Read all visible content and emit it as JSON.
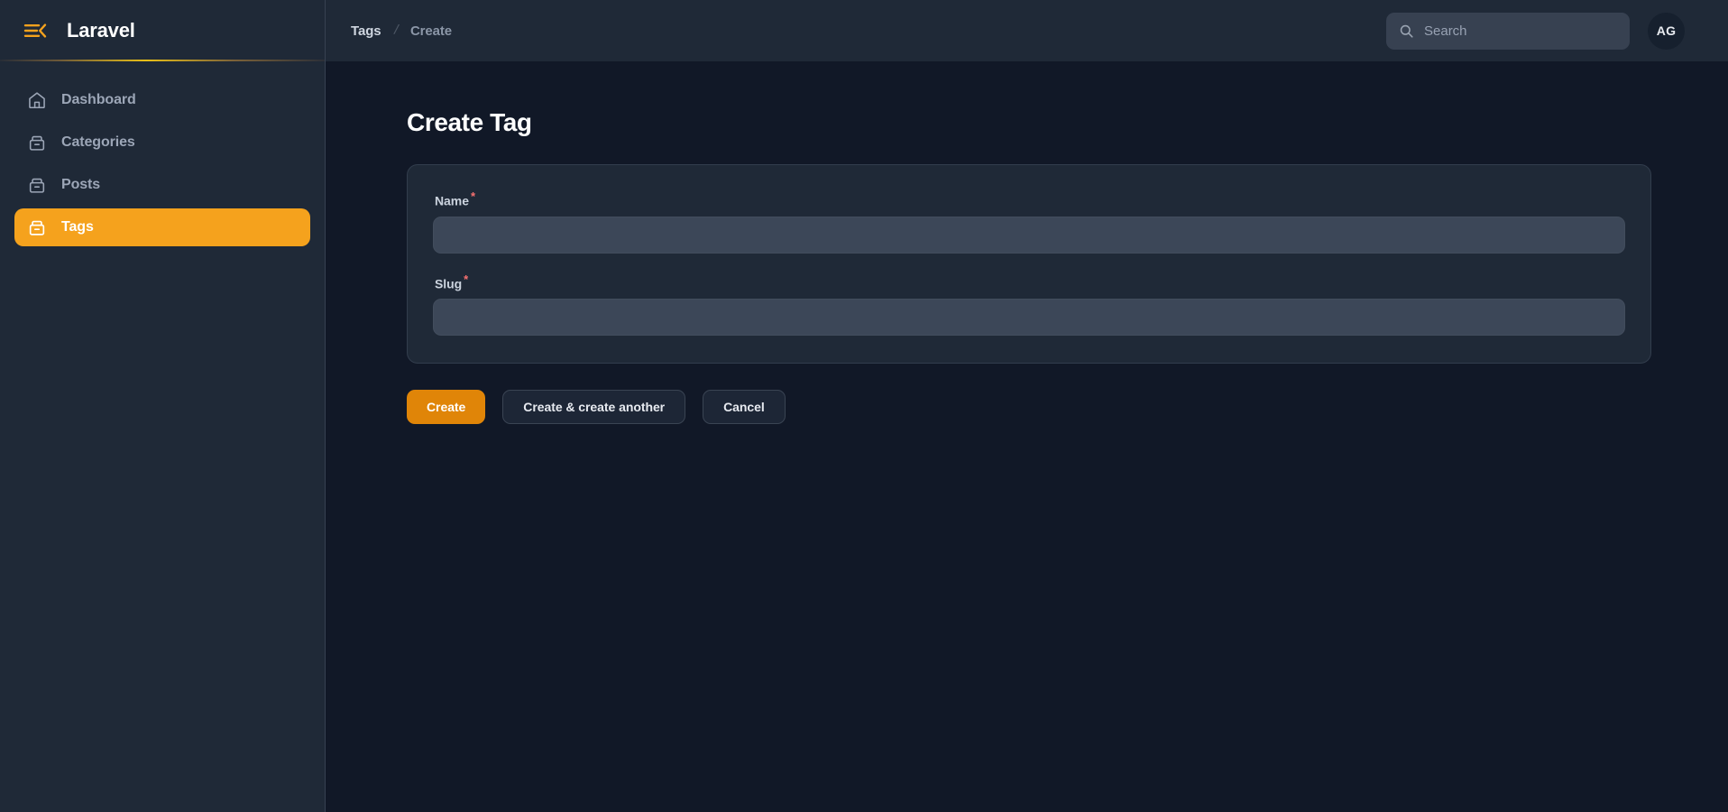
{
  "sidebar": {
    "brand": "Laravel",
    "collapse_icon": "sidebar-collapse-icon",
    "items": [
      {
        "label": "Dashboard",
        "icon": "home-icon",
        "active": false
      },
      {
        "label": "Categories",
        "icon": "archive-box-icon",
        "active": false
      },
      {
        "label": "Posts",
        "icon": "archive-box-icon",
        "active": false
      },
      {
        "label": "Tags",
        "icon": "archive-box-icon",
        "active": true
      }
    ]
  },
  "topbar": {
    "breadcrumb": {
      "parent": "Tags",
      "separator": "/",
      "current": "Create"
    },
    "search": {
      "icon": "search-icon",
      "placeholder": "Search",
      "value": ""
    },
    "avatar": {
      "initials": "AG"
    }
  },
  "main": {
    "page_title": "Create Tag",
    "form": {
      "fields": [
        {
          "label": "Name",
          "required_marker": "*",
          "value": "",
          "placeholder": ""
        },
        {
          "label": "Slug",
          "required_marker": "*",
          "value": "",
          "placeholder": ""
        }
      ]
    },
    "actions": [
      {
        "label": "Create",
        "style": "primary"
      },
      {
        "label": "Create & create another",
        "style": "secondary"
      },
      {
        "label": "Cancel",
        "style": "secondary"
      }
    ]
  },
  "colors": {
    "accent": "#f5a21d",
    "accent_button": "#e08508",
    "sidebar_bg": "#1f2937",
    "content_bg": "#111827",
    "card_bg": "#1f2937",
    "card_border": "#323d4d",
    "input_bg": "#3c4758",
    "required": "#f87171",
    "muted_text": "#9ca6b7"
  }
}
